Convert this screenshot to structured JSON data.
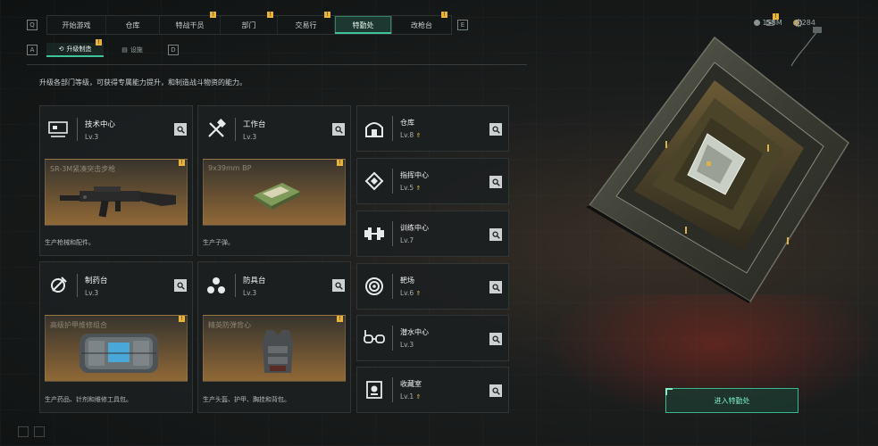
{
  "nav": {
    "left_key": "Q",
    "right_key": "E",
    "tabs": [
      {
        "label": "开始游戏",
        "badge": ""
      },
      {
        "label": "仓库",
        "badge": ""
      },
      {
        "label": "特战干员",
        "badge": "!"
      },
      {
        "label": "部门",
        "badge": "!"
      },
      {
        "label": "交易行",
        "badge": "!"
      },
      {
        "label": "特勤处",
        "badge": "",
        "active": true
      },
      {
        "label": "改枪台",
        "badge": "!"
      }
    ]
  },
  "currency": {
    "a": "158M",
    "b": "284"
  },
  "topbar": {
    "mail_badge": "!"
  },
  "subnav": {
    "left_key": "A",
    "right_key": "D",
    "tabs": [
      {
        "label": "升级制造",
        "badge": "!",
        "active": true
      },
      {
        "label": "设施",
        "badge": ""
      }
    ]
  },
  "description": "升级各部门等级，可获得专属能力提升，和制造战斗物资的能力。",
  "facilities": [
    {
      "name": "技术中心",
      "level": "Lv.3",
      "product": "SR-3M紧凑突击步枪",
      "footer": "生产枪械和配件。",
      "badge": "!"
    },
    {
      "name": "工作台",
      "level": "Lv.3",
      "product": "9x39mm BP",
      "footer": "生产子弹。",
      "badge": "!"
    },
    {
      "name": "制药台",
      "level": "Lv.3",
      "product": "高级护甲维修组合",
      "footer": "生产药品、针剂和维修工具包。",
      "badge": "!"
    },
    {
      "name": "防具台",
      "level": "Lv.3",
      "product": "精英防弹背心",
      "footer": "生产头盔、护甲、胸挂和背包。",
      "badge": "!"
    }
  ],
  "side_facilities": [
    {
      "name": "仓库",
      "level": "Lv.8",
      "upgradable": true
    },
    {
      "name": "指挥中心",
      "level": "Lv.5",
      "upgradable": true
    },
    {
      "name": "训练中心",
      "level": "Lv.7",
      "upgradable": false
    },
    {
      "name": "靶场",
      "level": "Lv.6",
      "upgradable": true
    },
    {
      "name": "潜水中心",
      "level": "Lv.3",
      "upgradable": false
    },
    {
      "name": "收藏室",
      "level": "Lv.1",
      "upgradable": true
    }
  ],
  "enter_button": "进入特勤处",
  "colors": {
    "accent": "#3fc39a",
    "badge": "#e8b43a",
    "upgrade": "#e2b84a"
  }
}
